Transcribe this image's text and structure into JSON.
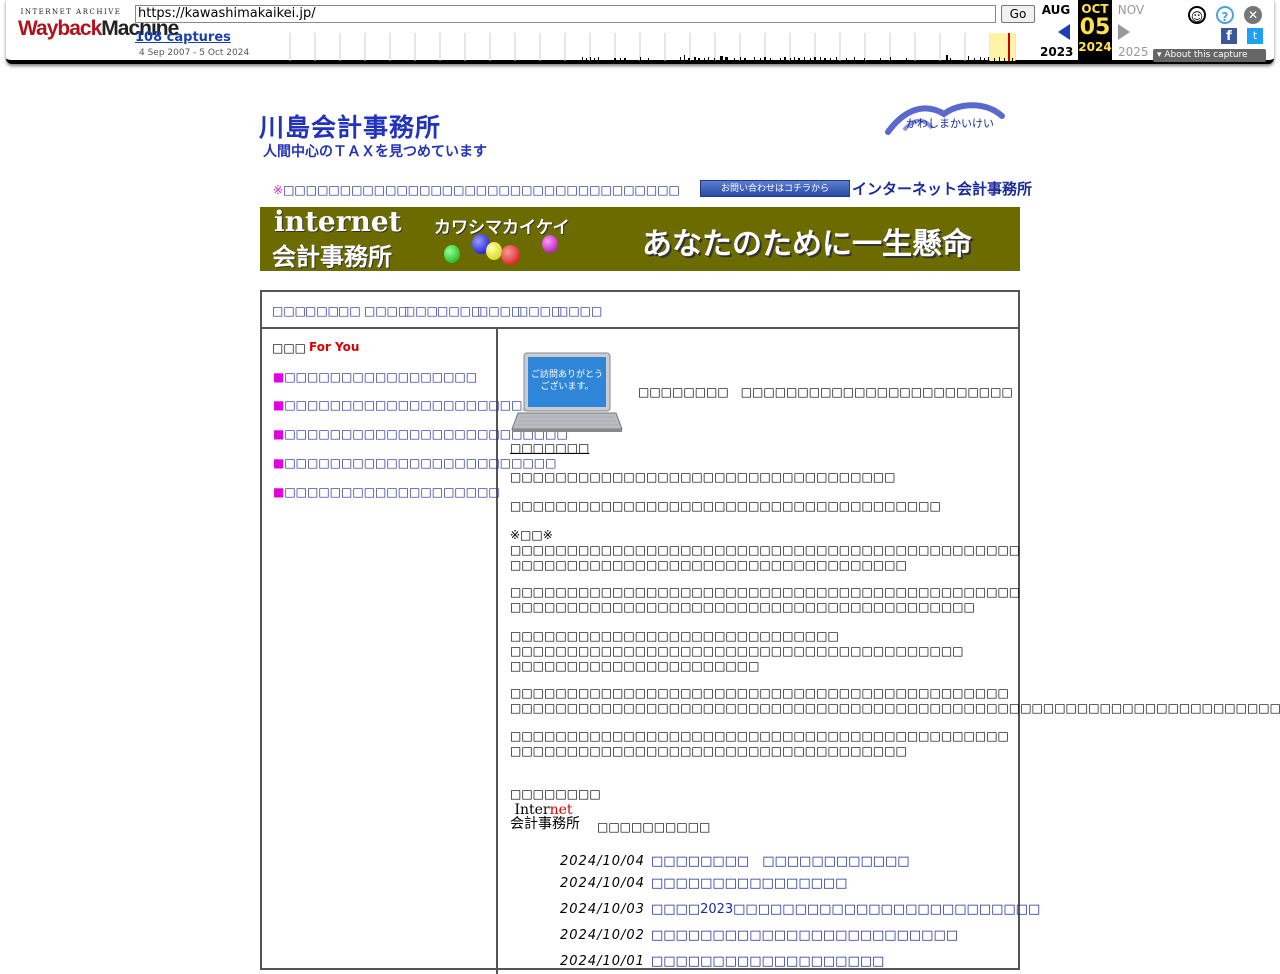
{
  "wayback": {
    "logo_top": "INTERNET ARCHIVE",
    "logo_main_1": "Wayback",
    "logo_main_2": "Machine",
    "url": "https://kawashimakaikei.jp/",
    "go_label": "Go",
    "captures": "108 captures",
    "range": "4 Sep 2007 - 5 Oct 2024",
    "prev_month": "AUG",
    "cur_month": "OCT",
    "cur_day": "05",
    "cur_year": "2024",
    "next_month": "NOV",
    "prev_year": "2023",
    "next_year": "2025",
    "about": "About this capture",
    "icons": {
      "user": "user-icon",
      "help": "help-icon",
      "close": "close-icon",
      "facebook": "facebook-icon",
      "twitter": "twitter-icon"
    }
  },
  "site": {
    "title": "川島会計事務所",
    "tagline": "人間中心のＴＡＸを見つめています",
    "logo_text": "かわしまかいけい",
    "notice": "□□□□□□□□□□□□□□□□□□□□□□□□□□□□□□□□□□□",
    "notice_mark": "※",
    "contact_button": "お問い合わせはコチラから",
    "contact_label": "インターネット会計事務所",
    "banner": {
      "line1": "internet",
      "line2": "会計事務所",
      "kana": "カワシマカイケイ",
      "slogan": "あなたのために一生懸命"
    }
  },
  "nav": [
    "□□□",
    "□□□",
    "□□",
    "□□□□",
    "□□□",
    "□□□□",
    "□□□□",
    "□□□□",
    "□□□□"
  ],
  "sidebar": {
    "heading": "□□□",
    "foryou": "For You",
    "items": [
      "□□□□□□□□□□□□□□□□□",
      "□□□□□□□□□□□□□□□□□□□□□□□□",
      "□□□□□□□□□□□□□□□□□□□□□□□□□",
      "□□□□□□□□□□□□□□□□□□□□□□□□",
      "□□□□□□□□□□□□□□□□□□□"
    ]
  },
  "main": {
    "laptop_text": "ご訪問ありがとうございます。",
    "welcome": "□□□□□□□□　□□□□□□□□□□□□□□□□□□□□□□□□",
    "heading": "□□□□□□□",
    "paragraphs": [
      "□□□□□□□□□□□□□□□□□□□□□□□□□□□□□□□□□□",
      "□□□□□□□□□□□□□□□□□□□□□□□□□□□□□□□□□□□□□□",
      "※□□※\n□□□□□□□□□□□□□□□□□□□□□□□□□□□□□□□□□□□□□□□□□□□□□\n□□□□□□□□□□□□□□□□□□□□□□□□□□□□□□□□□□□",
      "□□□□□□□□□□□□□□□□□□□□□□□□□□□□□□□□□□□□□□□□□□□□□\n□□□□□□□□□□□□□□□□□□□□□□□□□□□□□□□□□□□□□□□□□",
      "□□□□□□□□□□□□□□□□□□□□□□□□□□□□□\n□□□□□□□□□□□□□□□□□□□□□□□□□□□□□□□□□□□□□□□□\n□□□□□□□□□□□□□□□□□□□□□□",
      "□□□□□□□□□□□□□□□□□□□□□□□□□□□□□□□□□□□□□□□□□□□□\n□□□□□□□□□□□□□□□□□□□□□□□□□□□□□□□□□□□□□□□□□□□□□□□□□□□□□□□□□□□□□□□□□□□□□□□□",
      "□□□□□□□□□□□□□□□□□□□□□□□□□□□□□□□□□□□□□□□□□□□□\n□□□□□□□□□□□□□□□□□□□□□□□□□□□□□□□□□□□"
    ],
    "sign_pre": "□□□□□□□□",
    "net_logo_1a": "Inter",
    "net_logo_1b": "net",
    "net_logo_2": "会計事務所",
    "net_after": "□□□□□□□□□□",
    "news": [
      {
        "date": "2024/10/04",
        "title": "□□□□□□□□　□□□□□□□□□□□□"
      },
      {
        "date": "2024/10/04",
        "title": "□□□□□□□□□□□□□□□□"
      },
      {
        "date": "2024/10/03",
        "title": "□□□□2023□□□□□□□□□□□□□□□□□□□□□□□□□"
      },
      {
        "date": "2024/10/02",
        "title": "□□□□□□□□□□□□□□□□□□□□□□□□□"
      },
      {
        "date": "2024/10/01",
        "title": "□□□□□□□□□□□□□□□□□□□"
      }
    ]
  },
  "colors": {
    "link": "#1a2a9a",
    "banner_bg": "#6b6b00",
    "accent_red": "#dd0000",
    "bullet": "#e000e0"
  }
}
